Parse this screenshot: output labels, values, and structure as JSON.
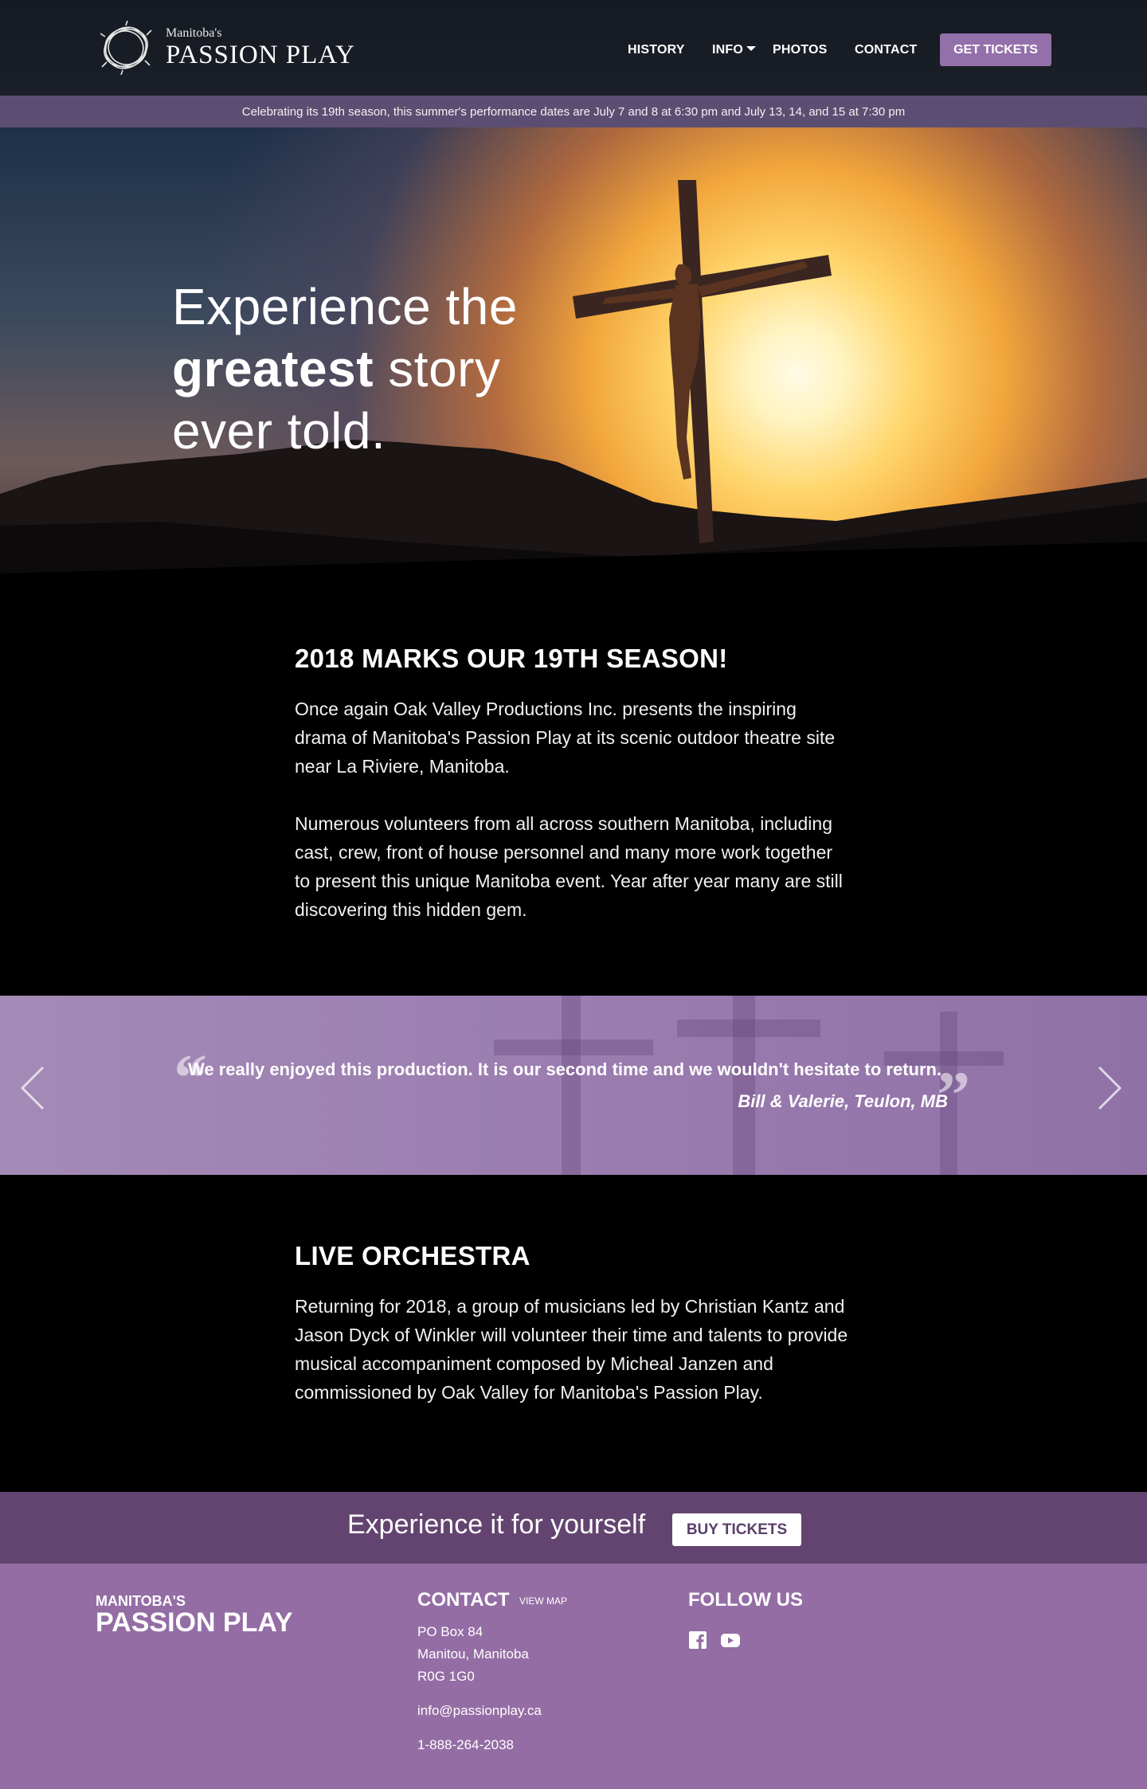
{
  "header": {
    "logo_small": "Manitoba's",
    "logo_big": "PASSION PLAY",
    "nav": [
      {
        "label": "HISTORY"
      },
      {
        "label": "INFO"
      },
      {
        "label": "PHOTOS"
      },
      {
        "label": "CONTACT"
      }
    ],
    "tickets_label": "GET TICKETS"
  },
  "announcement": "Celebrating its 19th season, this summer's performance dates are July 7 and 8 at 6:30 pm and July 13, 14, and 15 at 7:30 pm",
  "hero": {
    "line1": "Experience the",
    "line2_bold": "greatest",
    "line2_rest": " story",
    "line3": "ever told."
  },
  "season": {
    "title": "2018 MARKS OUR 19TH SEASON!",
    "p1": "Once again Oak Valley Productions Inc. presents the inspiring drama of Manitoba's Passion Play at its scenic outdoor theatre site near La Riviere, Manitoba.",
    "p2": "Numerous volunteers from all across southern Manitoba, including cast, crew, front of house personnel and many more work together to present this unique Manitoba event. Year after year many are still discovering this hidden gem."
  },
  "testimonial": {
    "quote": "We really enjoyed this production. It is our second time and we wouldn't hesitate to return.",
    "author": "Bill & Valerie, Teulon, MB",
    "open_mark": "“",
    "close_mark": "”"
  },
  "orchestra": {
    "title": "LIVE ORCHESTRA",
    "p1": "Returning for 2018, a group of musicians led by Christian Kantz and Jason Dyck of Winkler will volunteer their time and talents to provide musical accompaniment composed by Micheal Janzen and commissioned by Oak Valley for Manitoba's Passion Play."
  },
  "cta": {
    "text": "Experience it for yourself",
    "button": "BUY TICKETS"
  },
  "footer": {
    "brand_small": "MANITOBA'S",
    "brand_big": "PASSION PLAY",
    "contact_title": "CONTACT",
    "view_map": "VIEW MAP",
    "address": [
      "PO Box 84",
      "Manitou, Manitoba",
      "R0G 1G0"
    ],
    "email": "info@passionplay.ca",
    "phone": "1-888-264-2038",
    "follow_title": "FOLLOW US",
    "social": [
      "facebook-icon",
      "youtube-icon"
    ]
  },
  "colors": {
    "accent": "#9470aa",
    "announce_bar": "#5c4e72",
    "cta_bar": "#634470",
    "footer": "#946da4"
  }
}
